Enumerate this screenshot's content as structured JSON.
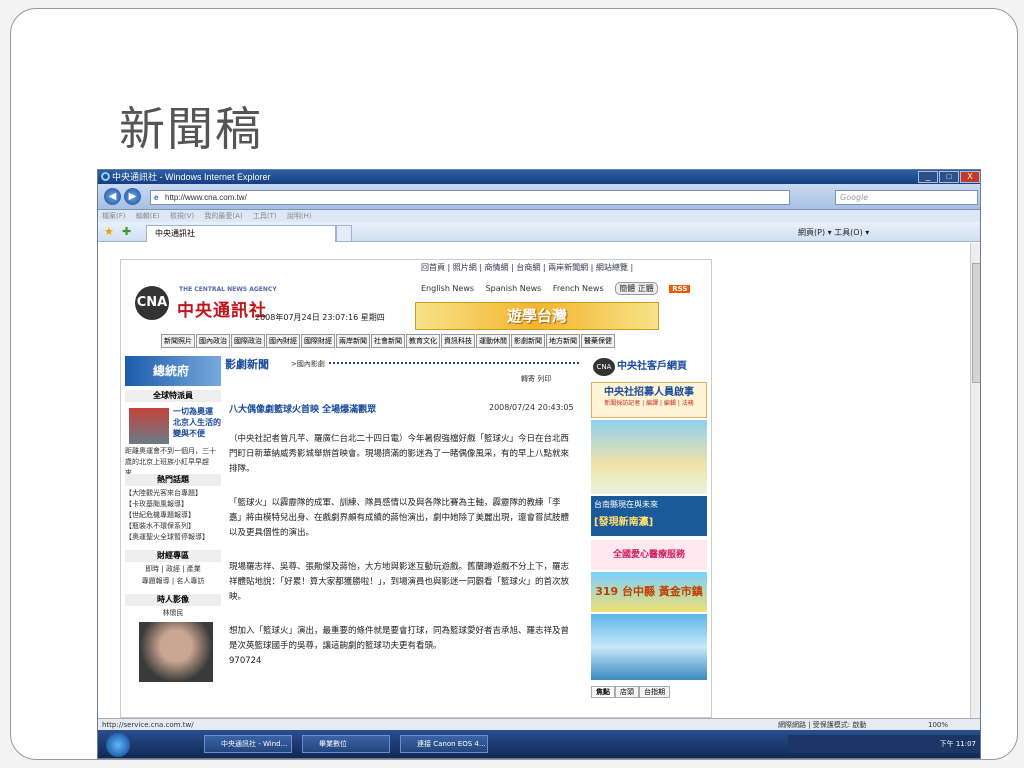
{
  "slide": {
    "title": "新聞稿"
  },
  "window": {
    "title": "中央通訊社 - Windows Internet Explorer",
    "minimize": "_",
    "maximize": "□",
    "close": "X"
  },
  "addressbar": {
    "url": "http://www.cna.com.tw/",
    "search_placeholder": "Google",
    "back": "◀",
    "forward": "▶"
  },
  "menubar": {
    "items": [
      "檔案(F)",
      "編輯(E)",
      "檢視(V)",
      "我的最愛(A)",
      "工具(T)",
      "說明(H)"
    ]
  },
  "tabbar": {
    "tab_label": "中央通訊社",
    "tools": "網頁(P) ▾  工具(O) ▾"
  },
  "site": {
    "top_links": "回首頁 | 照片網 | 商情網 | 台商網 | 兩岸新聞網 | 網站總覽 |",
    "lang_links": [
      "English News",
      "Spanish News",
      "French News"
    ],
    "hanzi_toggle": "簡體  正體",
    "rss": "RSS",
    "logo_text": "CNA",
    "agency_en": "THE CENTRAL NEWS AGENCY",
    "agency_zh": "中央通訊社",
    "datetime": "2008年07月24日 23:07:16 星期四",
    "banner": "遊學台灣",
    "categories": [
      "新聞照片",
      "國內政治",
      "國際政治",
      "國內財經",
      "國際財經",
      "兩岸新聞",
      "社會新聞",
      "教育文化",
      "資訊科技",
      "運動休閒",
      "影劇新聞",
      "地方新聞",
      "醫藥保健"
    ]
  },
  "left": {
    "zongtongfu": "總統府",
    "reporter_head": "全球特派員",
    "reporter_title": "一切為奧運 北京人生活的變與不便",
    "reporter_text": "距離奧運會不到一個月，三十歲的北京上班族小紅早早趕來…",
    "more": "more",
    "hot_head": "熱門話題",
    "hot_items": [
      "【大陸觀光客來台專題】",
      "【卡玫基颱風報導】",
      "【世紀危機專題報導】",
      "【瓶裝水不環保系列】",
      "【奧運聖火全球暫停報導】"
    ],
    "finance_head": "財經專區",
    "finance_text": "即時 | 政經 | 產業",
    "finance_text2": "專題報導 | 名人專訪",
    "people_head": "時人影像",
    "people_name": "林懷民"
  },
  "article": {
    "section": "影劇新聞",
    "subsection": ">國內影劇",
    "utils": "轉寄  列印",
    "headline": "八大偶像劇籃球火首映 全場爆滿觀眾",
    "time": "2008/07/24 20:43:05",
    "paragraphs": [
      "（中央社記者曾凡芊、羅廣仁台北二十四日電）今年暑假強檔好戲「籃球火」今日在台北西門町日新華納威秀影城舉辦首映會。現場擠滿的影迷為了一睹偶像風采，有的早上八點就來排隊。",
      "「籃球火」以霹靂隊的成軍、訓練、隊員感情以及與各隊比賽為主軸，霹靂隊的教練「李嘉」將由模特兒出身、在戲劇界頗有成績的蔣怡演出，劇中她除了美麗出現，還會嘗試肢體以及更具個性的演出。",
      "現場羅志祥、吳尊、張勛傑及蔣怡，大方地與影迷互動玩遊戲。舊蘭蹲遊戲不分上下，羅志祥體貼地說：「好累！算大家都獲勝啦！」，到場演員也與影迷一同觀看「籃球火」的首次放映。",
      "想加入「籃球火」演出，最重要的條件就是要會打球，同為籃球愛好者吉承旭、羅志祥及曾是次英籃球國手的吳尊，讓這齣劇的籃球功夫更有看頭。",
      "970724"
    ]
  },
  "right": {
    "home_title": "中央社客戶網頁",
    "ad1": "中央社招募人員啟事",
    "ad1_sub": "新聞採訪記者 | 編譯 | 編輯 | 法務",
    "ad3": "台南縣現在與未來",
    "ad3_sub": "[發現新南瀛]",
    "ad4": "全國愛心醫療服務",
    "ad5": "319 台中縣 黃金市鎮",
    "tabs": [
      "焦點",
      "店頭",
      "台指期"
    ]
  },
  "status": {
    "text": "http://service.cna.com.tw/",
    "zone": "網際網路 | 受保護模式: 啟動",
    "zoom": "100%"
  },
  "taskbar": {
    "tasks": [
      "中央通訊社 - Wind...",
      "畢業數位",
      "連接 Canon EOS 4..."
    ],
    "clock": "下午 11:07"
  }
}
